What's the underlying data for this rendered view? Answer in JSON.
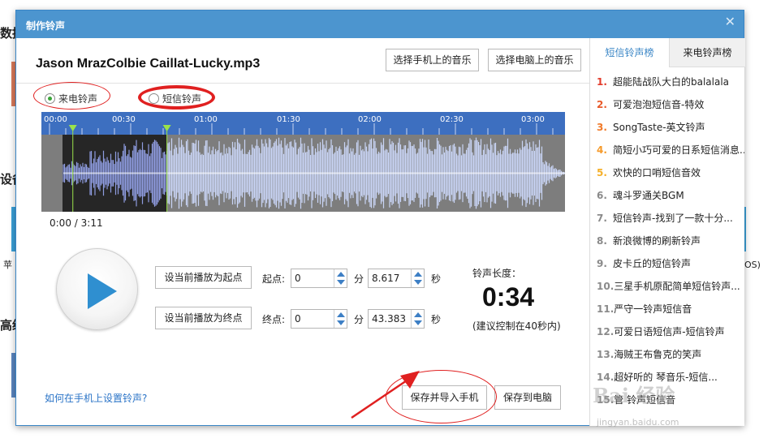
{
  "background": {
    "left_texts": [
      "数据",
      "设备",
      "苹",
      "高级"
    ],
    "right_text": "OS)"
  },
  "dialog": {
    "title": "制作铃声",
    "close_glyph": "✕",
    "filename": "Jason MrazColbie Caillat-Lucky.mp3",
    "select_phone_button": "选择手机上的音乐",
    "select_pc_button": "选择电脑上的音乐"
  },
  "ringtone_type": {
    "call_label": "来电铃声",
    "sms_label": "短信铃声",
    "selected": "call"
  },
  "waveform": {
    "ticks": [
      "00:00",
      "00:30",
      "01:00",
      "01:30",
      "02:00",
      "02:30",
      "03:00"
    ],
    "played_position": "0:00",
    "duration": "3:11",
    "time_separator": "/",
    "selection_start_seconds": 8.617,
    "selection_end_seconds": 43.383,
    "total_seconds": 191,
    "wave_color": "#c9d4f5",
    "ruler_color": "#3d6fc0"
  },
  "controls": {
    "set_start_button": "设当前播放为起点",
    "set_end_button": "设当前播放为终点",
    "start_label": "起点:",
    "end_label": "终点:",
    "start_min": "0",
    "start_sec": "8.617",
    "end_min": "0",
    "end_sec": "43.383",
    "min_unit": "分",
    "sec_unit": "秒"
  },
  "length": {
    "label": "铃声长度：",
    "value": "0:34",
    "hint": "(建议控制在40秒内)"
  },
  "footer": {
    "help_link": "如何在手机上设置铃声?",
    "save_import_button": "保存并导入手机",
    "save_pc_button": "保存到电脑"
  },
  "right_panel": {
    "tab_sms": "短信铃声榜",
    "tab_call": "来电铃声榜",
    "items": [
      {
        "num": "1.",
        "title": "超能陆战队大白的balalala"
      },
      {
        "num": "2.",
        "title": "可爱泡泡短信音-特效"
      },
      {
        "num": "3.",
        "title": "SongTaste-英文铃声"
      },
      {
        "num": "4.",
        "title": "简短小巧可爱的日系短信消息..."
      },
      {
        "num": "5.",
        "title": "欢快的口哨短信音效"
      },
      {
        "num": "6.",
        "title": "魂斗罗通关BGM"
      },
      {
        "num": "7.",
        "title": "短信铃声-找到了一款十分..."
      },
      {
        "num": "8.",
        "title": "新浪微博的刷新铃声"
      },
      {
        "num": "9.",
        "title": "皮卡丘的短信铃声"
      },
      {
        "num": "10.",
        "title": "三星手机原配简单短信铃声..."
      },
      {
        "num": "11.",
        "title": "严守一铃声短信音"
      },
      {
        "num": "12.",
        "title": "可爱日语短信声-短信铃声"
      },
      {
        "num": "13.",
        "title": "海贼王布鲁克的笑声"
      },
      {
        "num": "14.",
        "title": "超好听的 琴音乐-短信..."
      },
      {
        "num": "15.",
        "title": "管 铃声短信音"
      }
    ]
  },
  "watermark": {
    "main": "Bai 经验",
    "sub": "jingyan.baidu.com"
  },
  "colors": {
    "titlebar": "#4c95cf",
    "accent": "#3a86c6",
    "annotation_red": "#e02020"
  }
}
